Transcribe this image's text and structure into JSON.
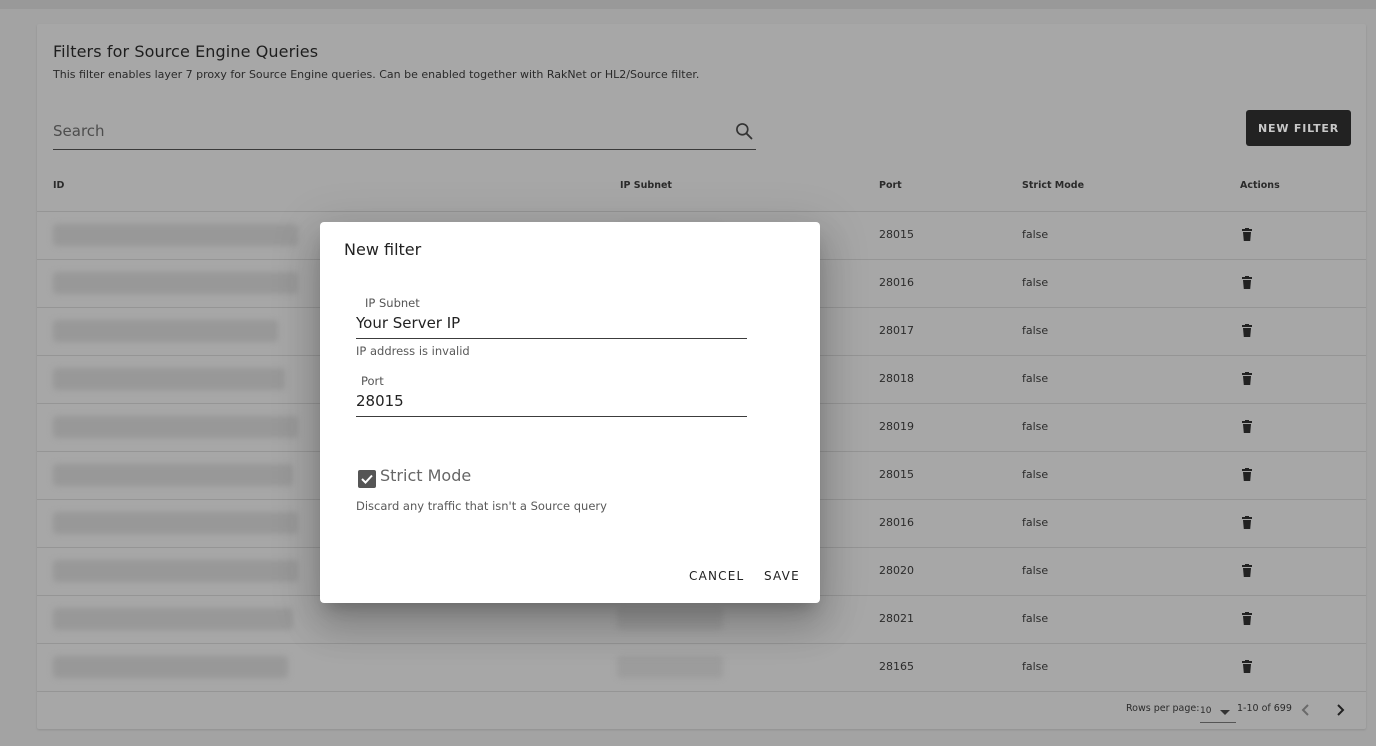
{
  "page": {
    "title": "Filters for Source Engine Queries",
    "description": "This filter enables layer 7 proxy for Source Engine queries. Can be enabled together with RakNet or HL2/Source filter.",
    "search_placeholder": "Search",
    "new_filter_label": "NEW FILTER"
  },
  "table": {
    "columns": [
      "ID",
      "IP Subnet",
      "Port",
      "Strict Mode",
      "Actions"
    ],
    "rows": [
      {
        "port": "28015",
        "strict_mode": "false"
      },
      {
        "port": "28016",
        "strict_mode": "false"
      },
      {
        "port": "28017",
        "strict_mode": "false"
      },
      {
        "port": "28018",
        "strict_mode": "false"
      },
      {
        "port": "28019",
        "strict_mode": "false"
      },
      {
        "port": "28015",
        "strict_mode": "false"
      },
      {
        "port": "28016",
        "strict_mode": "false"
      },
      {
        "port": "28020",
        "strict_mode": "false"
      },
      {
        "port": "28021",
        "strict_mode": "false"
      },
      {
        "port": "28165",
        "strict_mode": "false"
      }
    ]
  },
  "pagination": {
    "rows_per_page_label": "Rows per page:",
    "rows_per_page_value": "10",
    "range_label": "1-10 of 699"
  },
  "dialog": {
    "title": "New filter",
    "ip_label": "IP Subnet",
    "ip_value": "Your Server IP",
    "ip_error": "IP address is invalid",
    "port_label": "Port",
    "port_value": "28015",
    "strict_label": "Strict Mode",
    "strict_checked": true,
    "strict_helper": "Discard any traffic that isn't a Source query",
    "cancel_label": "CANCEL",
    "save_label": "SAVE"
  },
  "icons": {
    "search": "search-icon",
    "delete": "trash-icon",
    "prev": "chevron-left-icon",
    "next": "chevron-right-icon",
    "dropdown": "caret-down-icon",
    "check": "check-icon"
  }
}
